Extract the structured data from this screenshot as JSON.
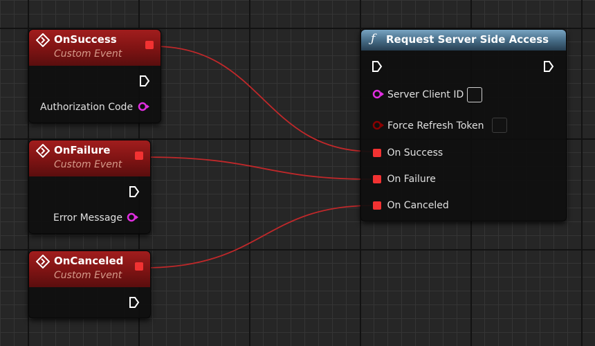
{
  "events": [
    {
      "title": "OnSuccess",
      "subtitle": "Custom Event",
      "output_label": "Authorization Code"
    },
    {
      "title": "OnFailure",
      "subtitle": "Custom Event",
      "output_label": "Error Message"
    },
    {
      "title": "OnCanceled",
      "subtitle": "Custom Event"
    }
  ],
  "function_node": {
    "title": "Request Server Side Access",
    "inputs": [
      {
        "label": "Server Client ID",
        "type": "string"
      },
      {
        "label": "Force Refresh Token",
        "type": "bool"
      },
      {
        "label": "On Success",
        "type": "delegate"
      },
      {
        "label": "On Failure",
        "type": "delegate"
      },
      {
        "label": "On Canceled",
        "type": "delegate"
      }
    ]
  },
  "colors": {
    "event_header": "#8f1a1a",
    "function_header": "#5b87a6",
    "delegate_pin": "#f23232",
    "string_pin": "#e12ee1",
    "bool_pin": "#8a0000",
    "wire": "#c0282a"
  },
  "connections": [
    {
      "from": "OnSuccess",
      "to": "On Success"
    },
    {
      "from": "OnFailure",
      "to": "On Failure"
    },
    {
      "from": "OnCanceled",
      "to": "On Canceled"
    }
  ]
}
